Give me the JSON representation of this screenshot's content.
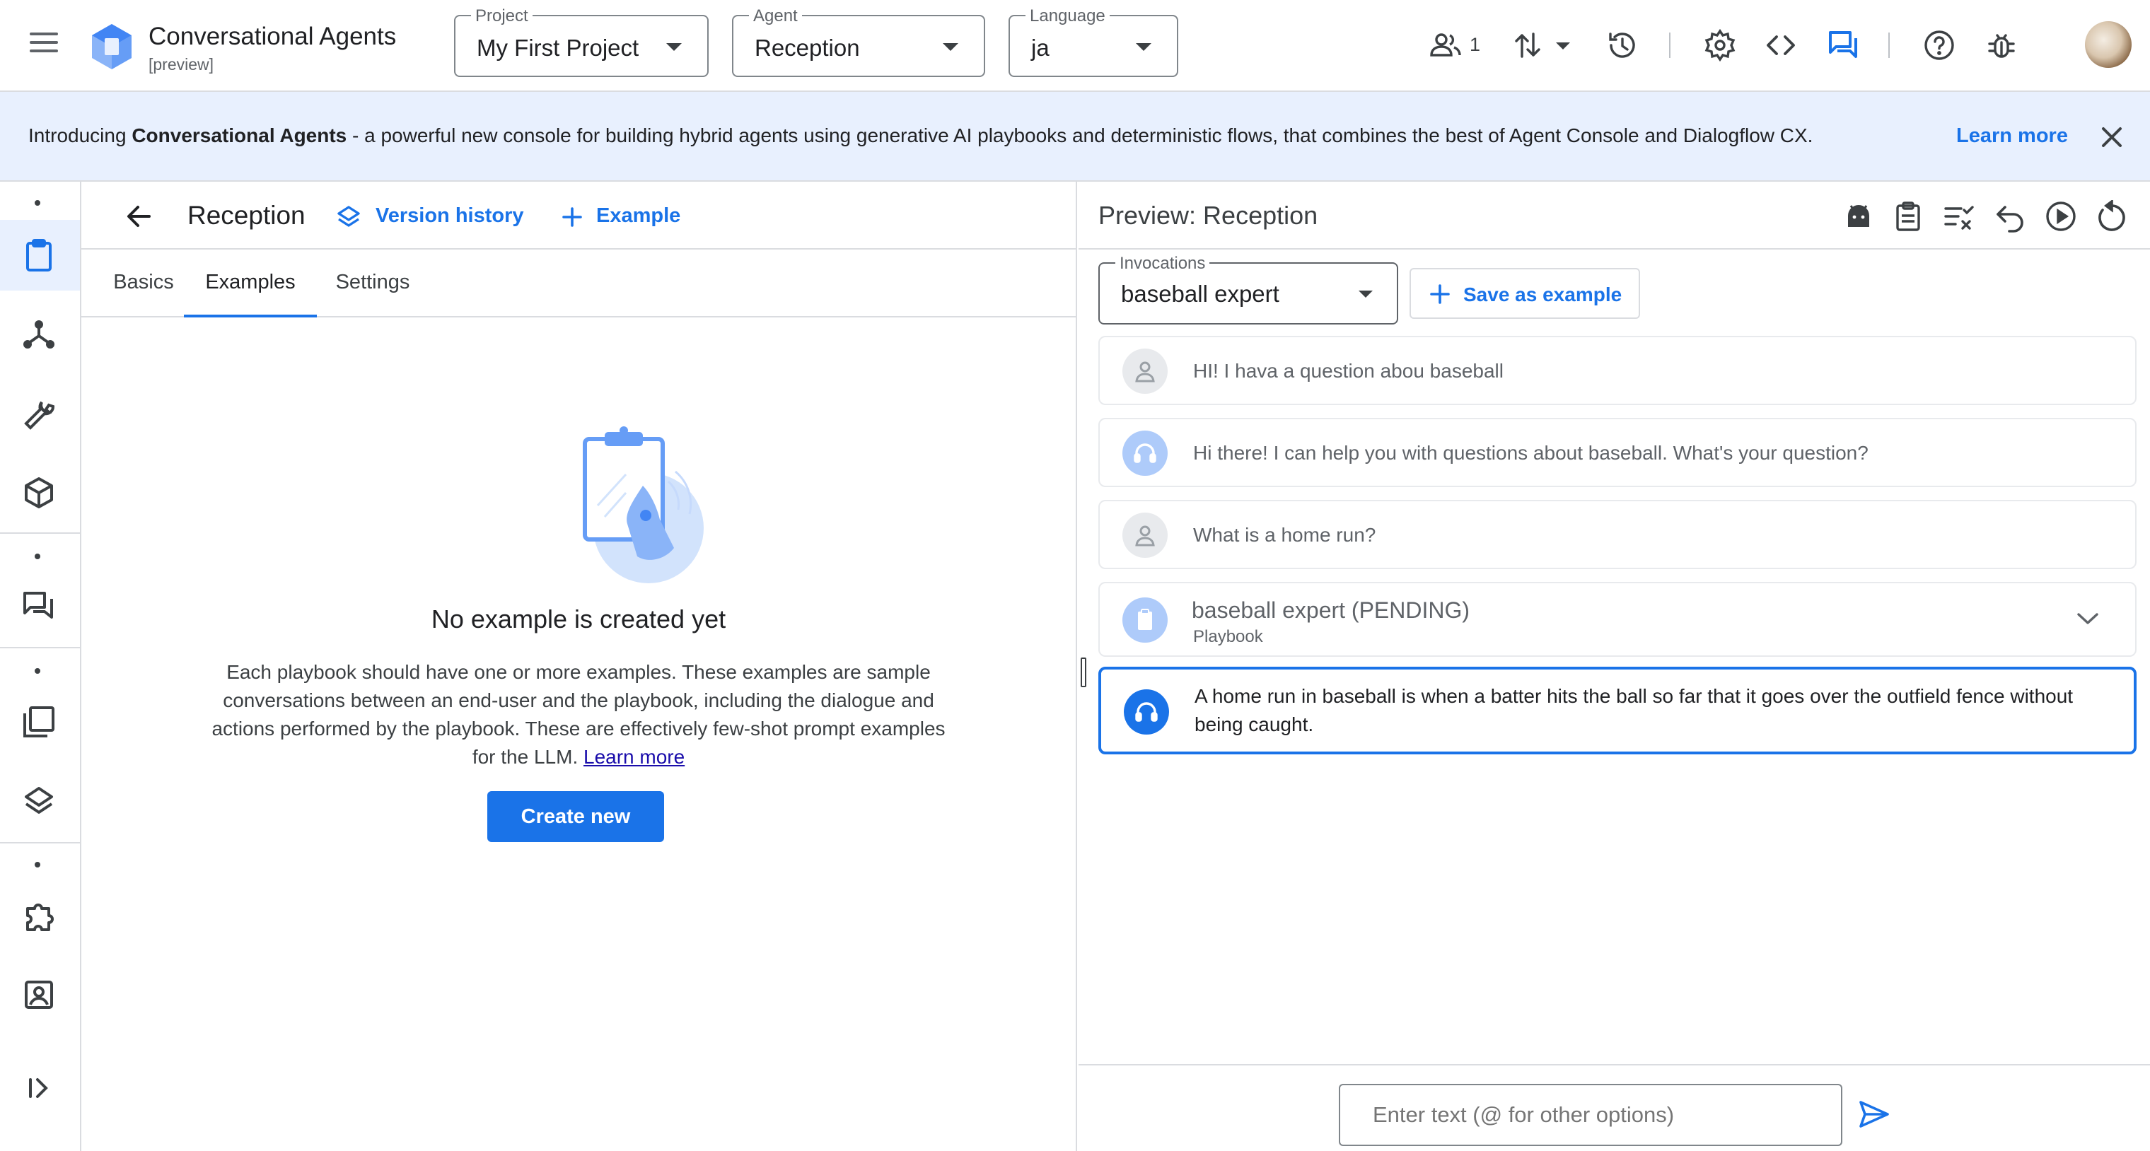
{
  "header": {
    "app_title": "Conversational Agents",
    "app_subtitle": "[preview]",
    "project": {
      "label": "Project",
      "value": "My First Project"
    },
    "agent": {
      "label": "Agent",
      "value": "Reception"
    },
    "language": {
      "label": "Language",
      "value": "ja"
    },
    "collaborators_count": "1",
    "icons": [
      "menu-icon",
      "people-icon",
      "import-export-icon",
      "history-icon",
      "settings-icon",
      "code-icon",
      "chat-icon",
      "help-icon",
      "bug-icon"
    ]
  },
  "banner": {
    "prefix": "Introducing ",
    "product": "Conversational Agents",
    "rest": " - a powerful new console for building hybrid agents using generative AI playbooks and deterministic flows, that combines the best of Agent Console and Dialogflow CX.",
    "learn_more": "Learn more"
  },
  "rail": {
    "items": [
      "playbooks-icon",
      "flows-icon",
      "tools-icon",
      "packages-icon",
      "conversations-icon",
      "data-store-icon",
      "layers-icon",
      "integrations-icon",
      "user-card-icon",
      "expand-icon"
    ]
  },
  "editor": {
    "title": "Reception",
    "version_history": "Version history",
    "add_example": "Example",
    "tabs": [
      "Basics",
      "Examples",
      "Settings"
    ],
    "active_tab": "Examples",
    "empty": {
      "title": "No example is created yet",
      "description": "Each playbook should have one or more examples. These examples are sample conversations between an end-user and the playbook, including the dialogue and actions performed by the playbook. These are effectively few-shot prompt examples for the LLM.",
      "learn_more": "Learn more",
      "create_button": "Create new"
    }
  },
  "preview": {
    "title": "Preview: Reception",
    "invocations": {
      "label": "Invocations",
      "value": "baseball expert"
    },
    "save_as_example": "Save as example",
    "messages": [
      {
        "role": "user",
        "text": "HI! I hava a question abou baseball"
      },
      {
        "role": "agent",
        "text": "Hi there! I can help you with questions about baseball. What's your question?"
      },
      {
        "role": "user",
        "text": "What is a home run?"
      },
      {
        "role": "playbook",
        "title": "baseball expert (PENDING)",
        "subtitle": "Playbook"
      },
      {
        "role": "agent",
        "line1": "A home run in baseball is when a batter hits the ball so far that it goes over the outfield fence without",
        "line2": "being caught."
      }
    ],
    "input_placeholder": "Enter text (@ for other options)"
  },
  "colors": {
    "accent": "#1a73e8",
    "banner_bg": "#e8f0fe",
    "rail_active": "#e8f0fe"
  }
}
